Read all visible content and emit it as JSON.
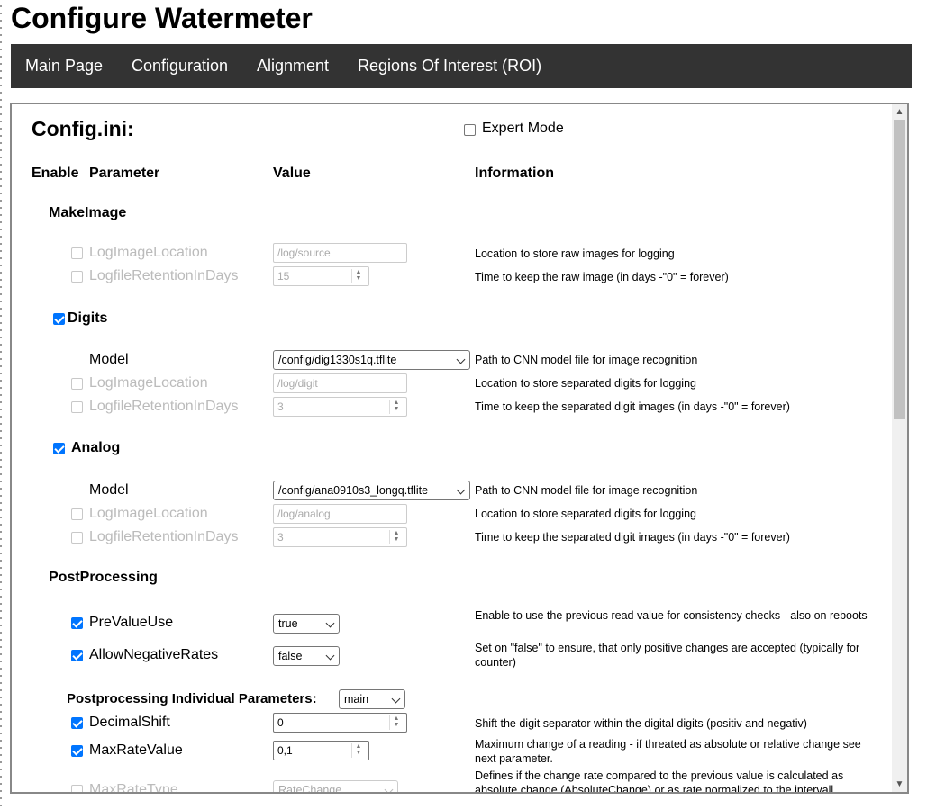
{
  "page_title": "Configure Watermeter",
  "nav": [
    "Main Page",
    "Configuration",
    "Alignment",
    "Regions Of Interest (ROI)"
  ],
  "config": {
    "title": "Config.ini:",
    "expert_mode_label": "Expert Mode",
    "headers": {
      "enable": "Enable",
      "parameter": "Parameter",
      "value": "Value",
      "information": "Information"
    }
  },
  "makeimage": {
    "title": "MakeImage",
    "log_image_location": {
      "label": "LogImageLocation",
      "value": "/log/source",
      "info": "Location to store raw images for logging"
    },
    "logfile_retention": {
      "label": "LogfileRetentionInDays",
      "value": "15",
      "info": "Time to keep the raw image (in days -\"0\" = forever)"
    }
  },
  "digits": {
    "title": "Digits",
    "model": {
      "label": "Model",
      "value": "/config/dig1330s1q.tflite",
      "info": "Path to CNN model file for image recognition"
    },
    "log_image_location": {
      "label": "LogImageLocation",
      "value": "/log/digit",
      "info": "Location to store separated digits for logging"
    },
    "logfile_retention": {
      "label": "LogfileRetentionInDays",
      "value": "3",
      "info": "Time to keep the separated digit images (in days -\"0\" = forever)"
    }
  },
  "analog": {
    "title": "Analog",
    "model": {
      "label": "Model",
      "value": "/config/ana0910s3_longq.tflite",
      "info": "Path to CNN model file for image recognition"
    },
    "log_image_location": {
      "label": "LogImageLocation",
      "value": "/log/analog",
      "info": "Location to store separated digits for logging"
    },
    "logfile_retention": {
      "label": "LogfileRetentionInDays",
      "value": "3",
      "info": "Time to keep the separated digit images (in days -\"0\" = forever)"
    }
  },
  "postprocessing": {
    "title": "PostProcessing",
    "prevalue_use": {
      "label": "PreValueUse",
      "value": "true",
      "info": "Enable to use the previous read value for consistency checks - also on reboots"
    },
    "allow_negative": {
      "label": "AllowNegativeRates",
      "value": "false",
      "info": "Set on \"false\" to ensure, that only positive changes are accepted (typically for counter)"
    },
    "individual_label": "Postprocessing Individual Parameters:",
    "individual_value": "main",
    "decimal_shift": {
      "label": "DecimalShift",
      "value": "0",
      "info": "Shift the digit separator within the digital digits (positiv and negativ)"
    },
    "max_rate_value": {
      "label": "MaxRateValue",
      "value": "0,1",
      "info": "Maximum change of a reading - if threated as absolute or relative change see next parameter."
    },
    "max_rate_type": {
      "label": "MaxRateType",
      "value": "RateChange",
      "info": "Defines if the change rate compared to the previous value is calculated as absolute change (AbsoluteChange) or as rate normalized to the intervall"
    }
  }
}
